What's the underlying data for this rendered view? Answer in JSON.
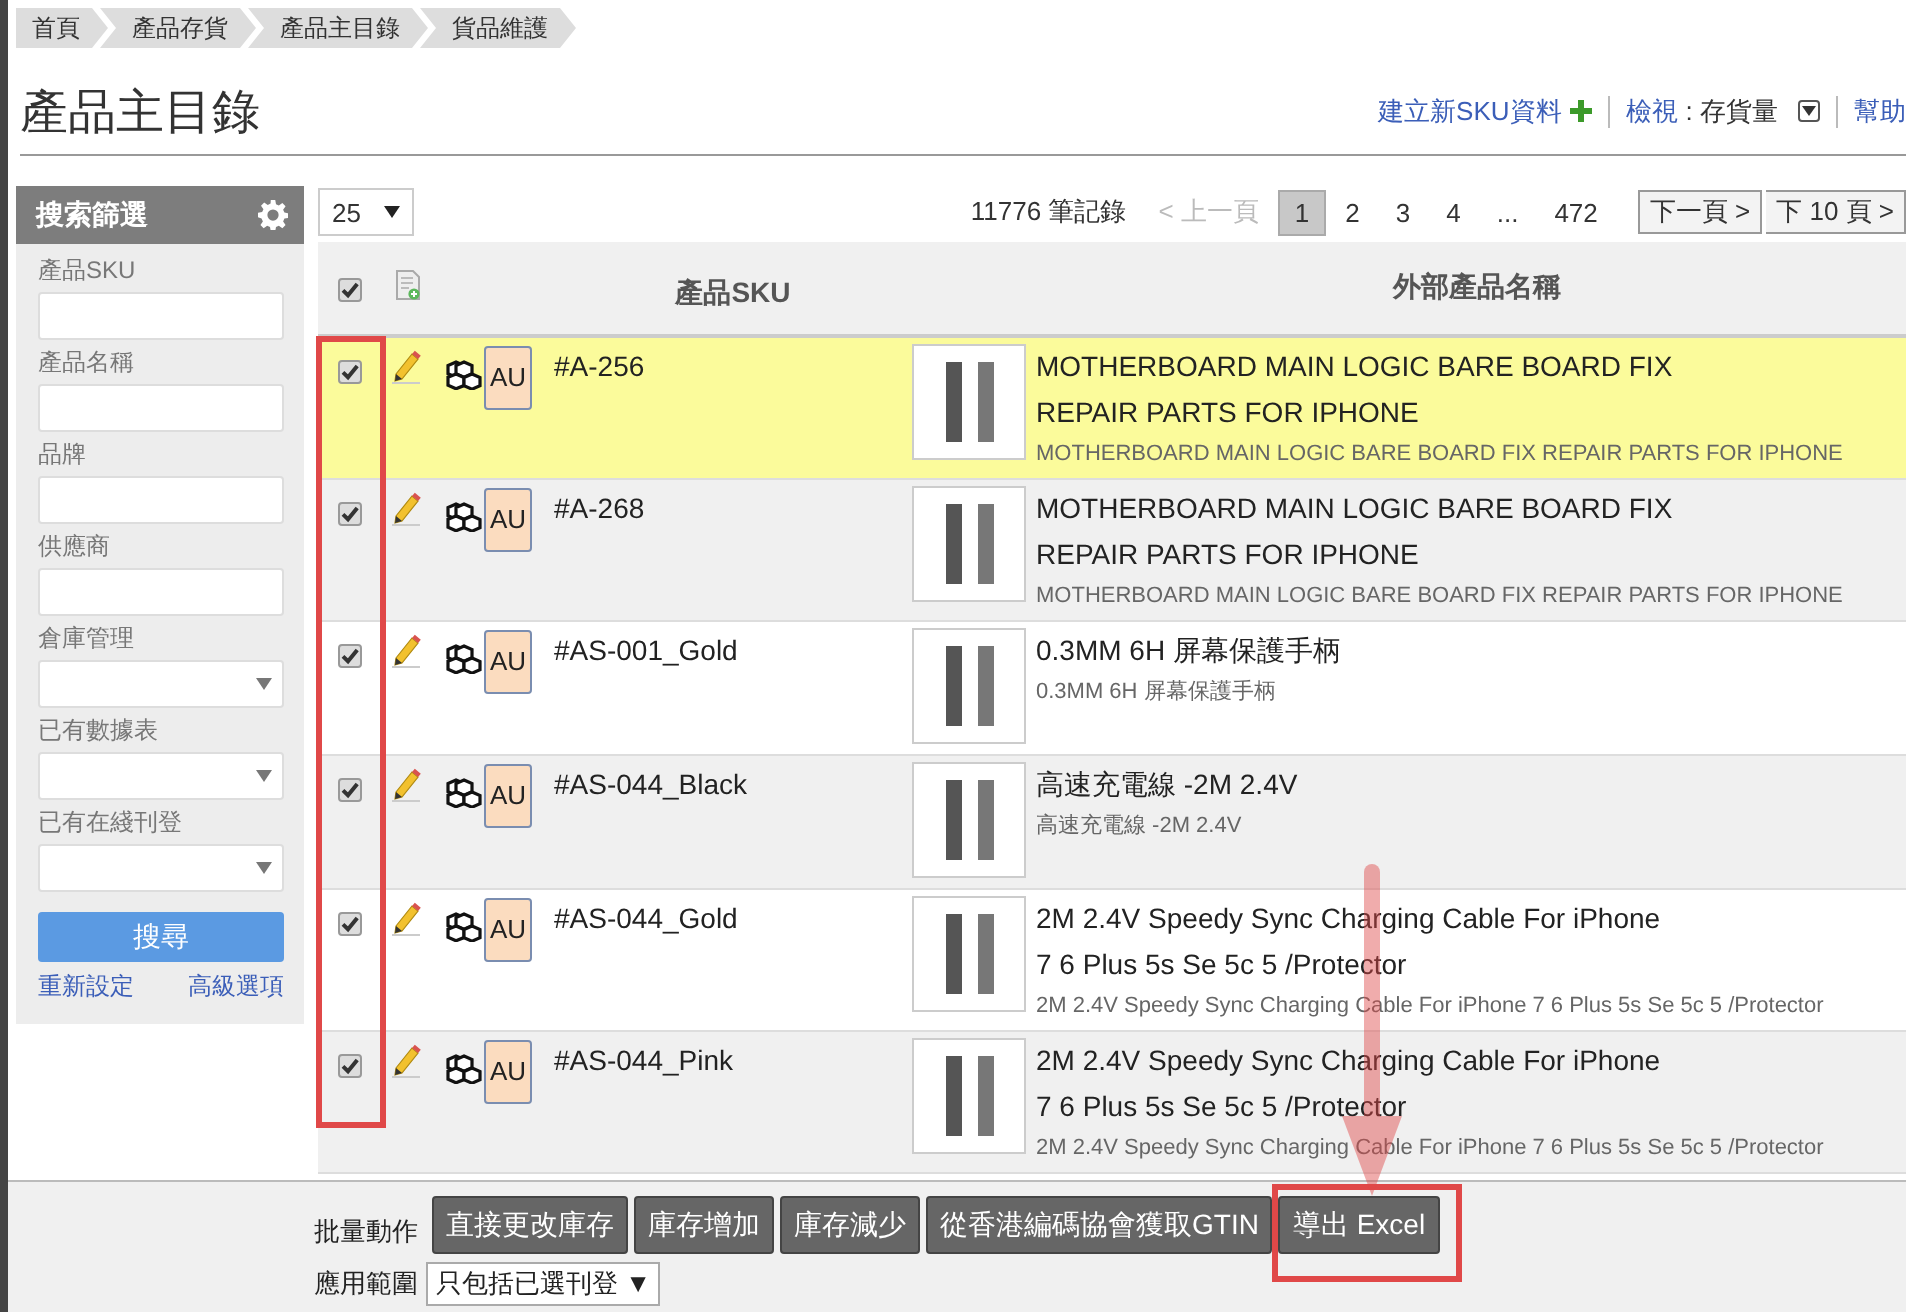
{
  "breadcrumb": [
    "首頁",
    "產品存貨",
    "產品主目錄",
    "貨品維護"
  ],
  "title": "產品主目錄",
  "header_links": {
    "create": "建立新SKU資料",
    "view_label": "檢視",
    "view_value": ": 存貨量",
    "help": "幫助"
  },
  "filter": {
    "title": "搜索篩選",
    "fields": [
      {
        "label": "產品SKU",
        "kind": "text"
      },
      {
        "label": "產品名稱",
        "kind": "text"
      },
      {
        "label": "品牌",
        "kind": "text"
      },
      {
        "label": "供應商",
        "kind": "text"
      },
      {
        "label": "倉庫管理",
        "kind": "select"
      },
      {
        "label": "已有數據表",
        "kind": "select"
      },
      {
        "label": "已有在綫刊登",
        "kind": "select"
      }
    ],
    "search_button": "搜尋",
    "reset_link": "重新設定",
    "advanced_link": "高級選項"
  },
  "toolbar": {
    "page_size": "25",
    "record_count": "11776 筆記錄",
    "prev": {
      "label": "< 上一頁",
      "disabled": true
    },
    "pages": [
      {
        "label": "1",
        "kind": "page",
        "selected": true
      },
      {
        "label": "2",
        "kind": "page",
        "selected": false
      },
      {
        "label": "3",
        "kind": "page",
        "selected": false
      },
      {
        "label": "4",
        "kind": "page",
        "selected": false
      },
      {
        "label": "...",
        "kind": "ellipsis",
        "selected": false
      },
      {
        "label": "472",
        "kind": "page",
        "selected": false
      }
    ],
    "next": "下一頁 >",
    "next10": "下 10 頁 >"
  },
  "table": {
    "select_all_checked": true,
    "columns": [
      "產品SKU",
      "外部產品名稱"
    ],
    "rows": [
      {
        "checked": true,
        "highlighted": true,
        "badge": "AU",
        "sku": "#A-256",
        "name": "MOTHERBOARD MAIN LOGIC BARE BOARD FIX REPAIR PARTS FOR IPHONE",
        "subtitle": "MOTHERBOARD MAIN LOGIC BARE BOARD FIX REPAIR PARTS FOR IPHONE"
      },
      {
        "checked": true,
        "highlighted": false,
        "badge": "AU",
        "sku": "#A-268",
        "name": "MOTHERBOARD MAIN LOGIC BARE BOARD FIX REPAIR PARTS FOR IPHONE",
        "subtitle": "MOTHERBOARD MAIN LOGIC BARE BOARD FIX REPAIR PARTS FOR IPHONE"
      },
      {
        "checked": true,
        "highlighted": false,
        "badge": "AU",
        "sku": "#AS-001_Gold",
        "name": "0.3MM 6H 屏幕保護手柄",
        "subtitle": "0.3MM 6H 屏幕保護手柄"
      },
      {
        "checked": true,
        "highlighted": false,
        "badge": "AU",
        "sku": "#AS-044_Black",
        "name": "高速充電線 -2M 2.4V",
        "subtitle": "高速充電線 -2M 2.4V"
      },
      {
        "checked": true,
        "highlighted": false,
        "badge": "AU",
        "sku": "#AS-044_Gold",
        "name": "2M 2.4V Speedy Sync Charging Cable For iPhone 7 6 Plus 5s Se 5c 5 /Protector",
        "subtitle": "2M 2.4V Speedy Sync Charging Cable For iPhone 7 6 Plus 5s Se 5c 5 /Protector"
      },
      {
        "checked": true,
        "highlighted": false,
        "badge": "AU",
        "sku": "#AS-044_Pink",
        "name": "2M 2.4V Speedy Sync Charging Cable For iPhone 7 6 Plus 5s Se 5c 5 /Protector",
        "subtitle": "2M 2.4V Speedy Sync Charging Cable For iPhone 7 6 Plus 5s Se 5c 5 /Protector"
      }
    ]
  },
  "bulk": {
    "label": "批量動作",
    "buttons": [
      "直接更改庫存",
      "庫存增加",
      "庫存減少",
      "從香港編碼協會獲取GTIN",
      "導出 Excel"
    ],
    "scope_label": "應用範圍",
    "scope_value": "只包括已選刊登 ▼"
  }
}
